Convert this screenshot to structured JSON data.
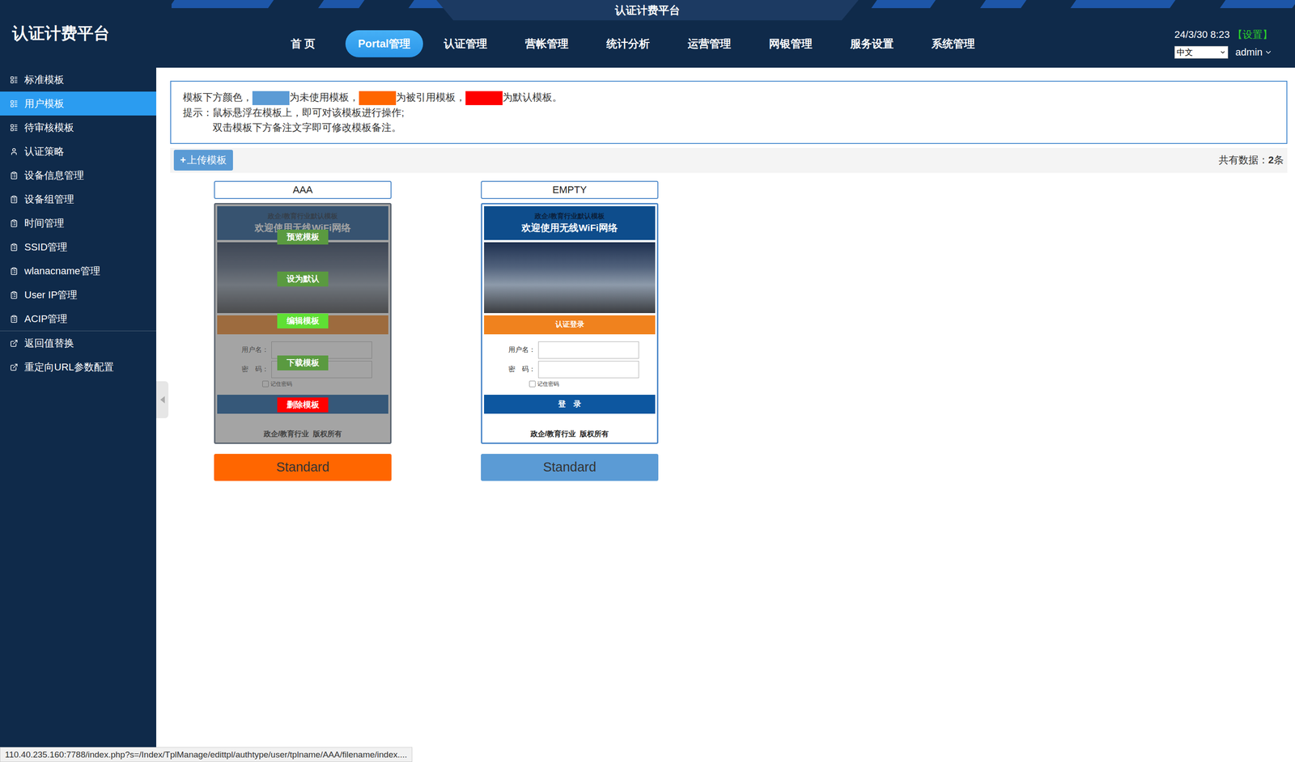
{
  "app": {
    "title": "认证计费平台",
    "banner": "认证计费平台"
  },
  "nav": [
    {
      "label": "首 页",
      "selected": false
    },
    {
      "label": "Portal管理",
      "selected": true
    },
    {
      "label": "认证管理",
      "selected": false
    },
    {
      "label": "营帐管理",
      "selected": false
    },
    {
      "label": "统计分析",
      "selected": false
    },
    {
      "label": "运营管理",
      "selected": false
    },
    {
      "label": "网银管理",
      "selected": false
    },
    {
      "label": "服务设置",
      "selected": false
    },
    {
      "label": "系统管理",
      "selected": false
    }
  ],
  "header_right": {
    "datetime": "24/3/30 8:23",
    "settings": "【设置】",
    "language": "中文",
    "user": "admin"
  },
  "sidebar": {
    "groups": [
      [
        {
          "label": "标准模板",
          "kind": "template",
          "selected": false
        },
        {
          "label": "用户模板",
          "kind": "template",
          "selected": true
        },
        {
          "label": "待审核模板",
          "kind": "template",
          "selected": false
        },
        {
          "label": "认证策略",
          "kind": "policy",
          "selected": false
        },
        {
          "label": "设备信息管理",
          "kind": "device",
          "selected": false
        },
        {
          "label": "设备组管理",
          "kind": "device",
          "selected": false
        },
        {
          "label": "时间管理",
          "kind": "device",
          "selected": false
        },
        {
          "label": "SSID管理",
          "kind": "device",
          "selected": false
        },
        {
          "label": "wlanacname管理",
          "kind": "device",
          "selected": false
        },
        {
          "label": "User IP管理",
          "kind": "device",
          "selected": false
        },
        {
          "label": "ACIP管理",
          "kind": "device",
          "selected": false
        }
      ],
      [
        {
          "label": "返回值替换",
          "kind": "link",
          "selected": false
        },
        {
          "label": "重定向URL参数配置",
          "kind": "link",
          "selected": false
        }
      ]
    ]
  },
  "notice": {
    "prefix": "模板下方颜色，",
    "legend": [
      {
        "color": "#5b9bd5",
        "text": "为未使用模板，"
      },
      {
        "color": "#ff6600",
        "text": "为被引用模板，"
      },
      {
        "color": "#ff0000",
        "text": "为默认模板。"
      }
    ],
    "tip_label": "提示：",
    "tips": [
      "鼠标悬浮在模板上，即可对该模板进行操作;",
      "双击模板下方备注文字即可修改模板备注。"
    ]
  },
  "toolbar": {
    "upload_icon": "+",
    "upload": "上传模板",
    "total_label": "共有数据：",
    "total": "2",
    "total_unit": "条"
  },
  "template_actions": [
    {
      "label": "预览模板",
      "color": "#5a9a40"
    },
    {
      "label": "设为默认",
      "color": "#5a9a40"
    },
    {
      "label": "编辑模板",
      "color": "#5fe034"
    },
    {
      "label": "下载模板",
      "color": "#5a9a40"
    },
    {
      "label": "删除模板",
      "color": "#ff0000"
    }
  ],
  "templates": [
    {
      "name": "AAA",
      "note": "Standard",
      "color": "#ff6600",
      "hovered": true,
      "preview": {
        "subtitle": "政企/教育行业默认模板",
        "title": "欢迎使用无线WiFi网络",
        "login_bar": "认证登录",
        "username_label": "用户名：",
        "password_label": "密　码：",
        "remember": "记住密码",
        "remember_checked": false,
        "login_button": "登　录",
        "footer": "政企/教育行业  版权所有"
      }
    },
    {
      "name": "EMPTY",
      "note": "Standard",
      "color": "#5b9bd5",
      "hovered": false,
      "preview": {
        "subtitle": "政企/教育行业默认模板",
        "title": "欢迎使用无线WiFi网络",
        "login_bar": "认证登录",
        "username_label": "用户名：",
        "password_label": "密　码：",
        "remember": "记住密码",
        "remember_checked": false,
        "login_button": "登　录",
        "footer": "政企/教育行业  版权所有"
      }
    }
  ],
  "status_bar": "110.40.235.160:7788/index.php?s=/Index/TplManage/edittpl/authtype/user/tplname/AAA/filename/index...."
}
